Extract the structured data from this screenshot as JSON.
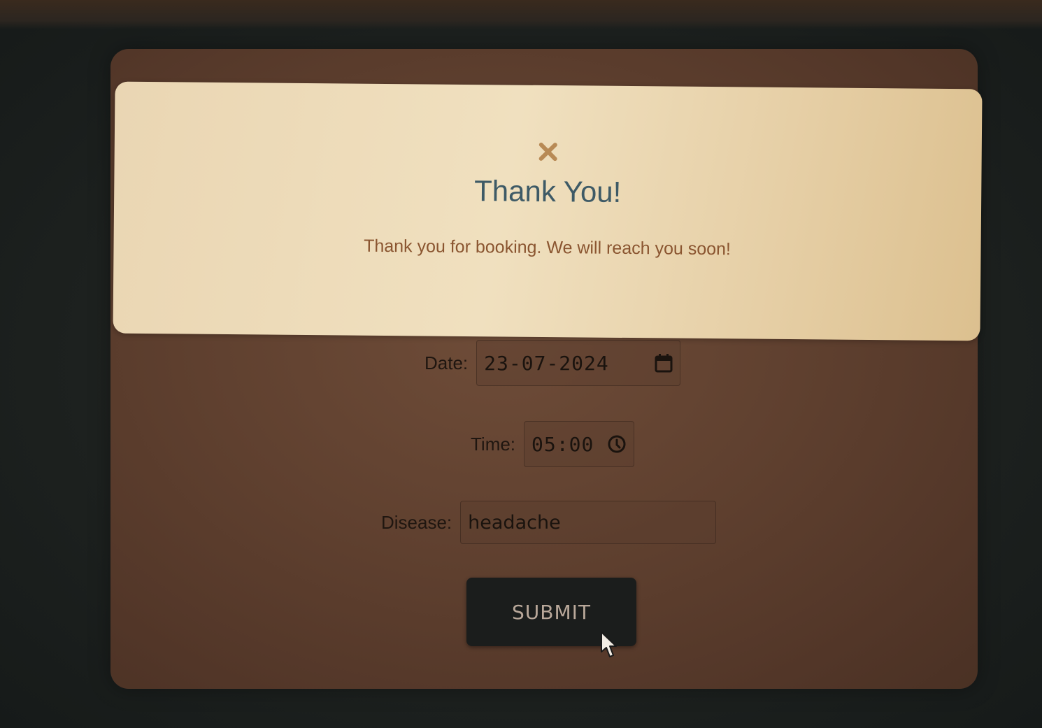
{
  "modal": {
    "close_icon": "close-x-icon",
    "title": "Thank You!",
    "message": "Thank you for booking. We will reach you soon!"
  },
  "form": {
    "date": {
      "label": "Date:",
      "value": "23-07-2024",
      "icon": "calendar-icon"
    },
    "time": {
      "label": "Time:",
      "value": "05:00",
      "icon": "clock-icon"
    },
    "disease": {
      "label": "Disease:",
      "value": "headache"
    },
    "submit_label": "SUBMIT"
  },
  "colors": {
    "card_background": "#5f402f",
    "modal_background": "#f0e0bf",
    "title_color": "#3e5a66",
    "message_color": "#8a5530",
    "close_icon_color": "#b88a55",
    "button_background": "#1b1d1c",
    "button_text": "#b9a89a"
  }
}
